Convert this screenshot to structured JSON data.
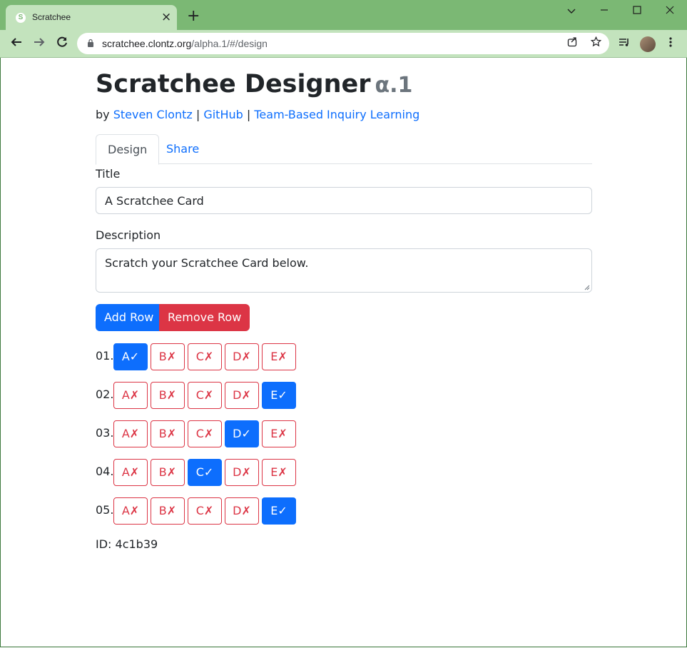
{
  "browser": {
    "tab_title": "Scratchee",
    "tab_favicon_letter": "S",
    "url_host": "scratchee.clontz.org",
    "url_path": "/alpha.1/#/design"
  },
  "header": {
    "title": "Scratchee Designer",
    "version": "α.1",
    "by": "by",
    "author": "Steven Clontz",
    "sep1": "|",
    "github": "GitHub",
    "sep2": "|",
    "tbil": "Team-Based Inquiry Learning"
  },
  "tabs": [
    {
      "label": "Design",
      "active": true
    },
    {
      "label": "Share",
      "active": false
    }
  ],
  "form": {
    "title_label": "Title",
    "title_value": "A Scratchee Card",
    "description_label": "Description",
    "description_value": "Scratch your Scratchee Card below."
  },
  "buttons": {
    "add_row": "Add Row",
    "remove_row": "Remove Row"
  },
  "rows": [
    {
      "num": "01.",
      "options": [
        "A✓",
        "B✗",
        "C✗",
        "D✗",
        "E✗"
      ],
      "correct": 0
    },
    {
      "num": "02.",
      "options": [
        "A✗",
        "B✗",
        "C✗",
        "D✗",
        "E✓"
      ],
      "correct": 4
    },
    {
      "num": "03.",
      "options": [
        "A✗",
        "B✗",
        "C✗",
        "D✓",
        "E✗"
      ],
      "correct": 3
    },
    {
      "num": "04.",
      "options": [
        "A✗",
        "B✗",
        "C✓",
        "D✗",
        "E✗"
      ],
      "correct": 2
    },
    {
      "num": "05.",
      "options": [
        "A✗",
        "B✗",
        "C✗",
        "D✗",
        "E✓"
      ],
      "correct": 4
    }
  ],
  "id_line": "ID: 4c1b39",
  "colors": {
    "primary": "#0d6efd",
    "danger": "#dc3545",
    "chrome_frame": "#7bb874",
    "chrome_toolbar": "#c3e3bd"
  }
}
